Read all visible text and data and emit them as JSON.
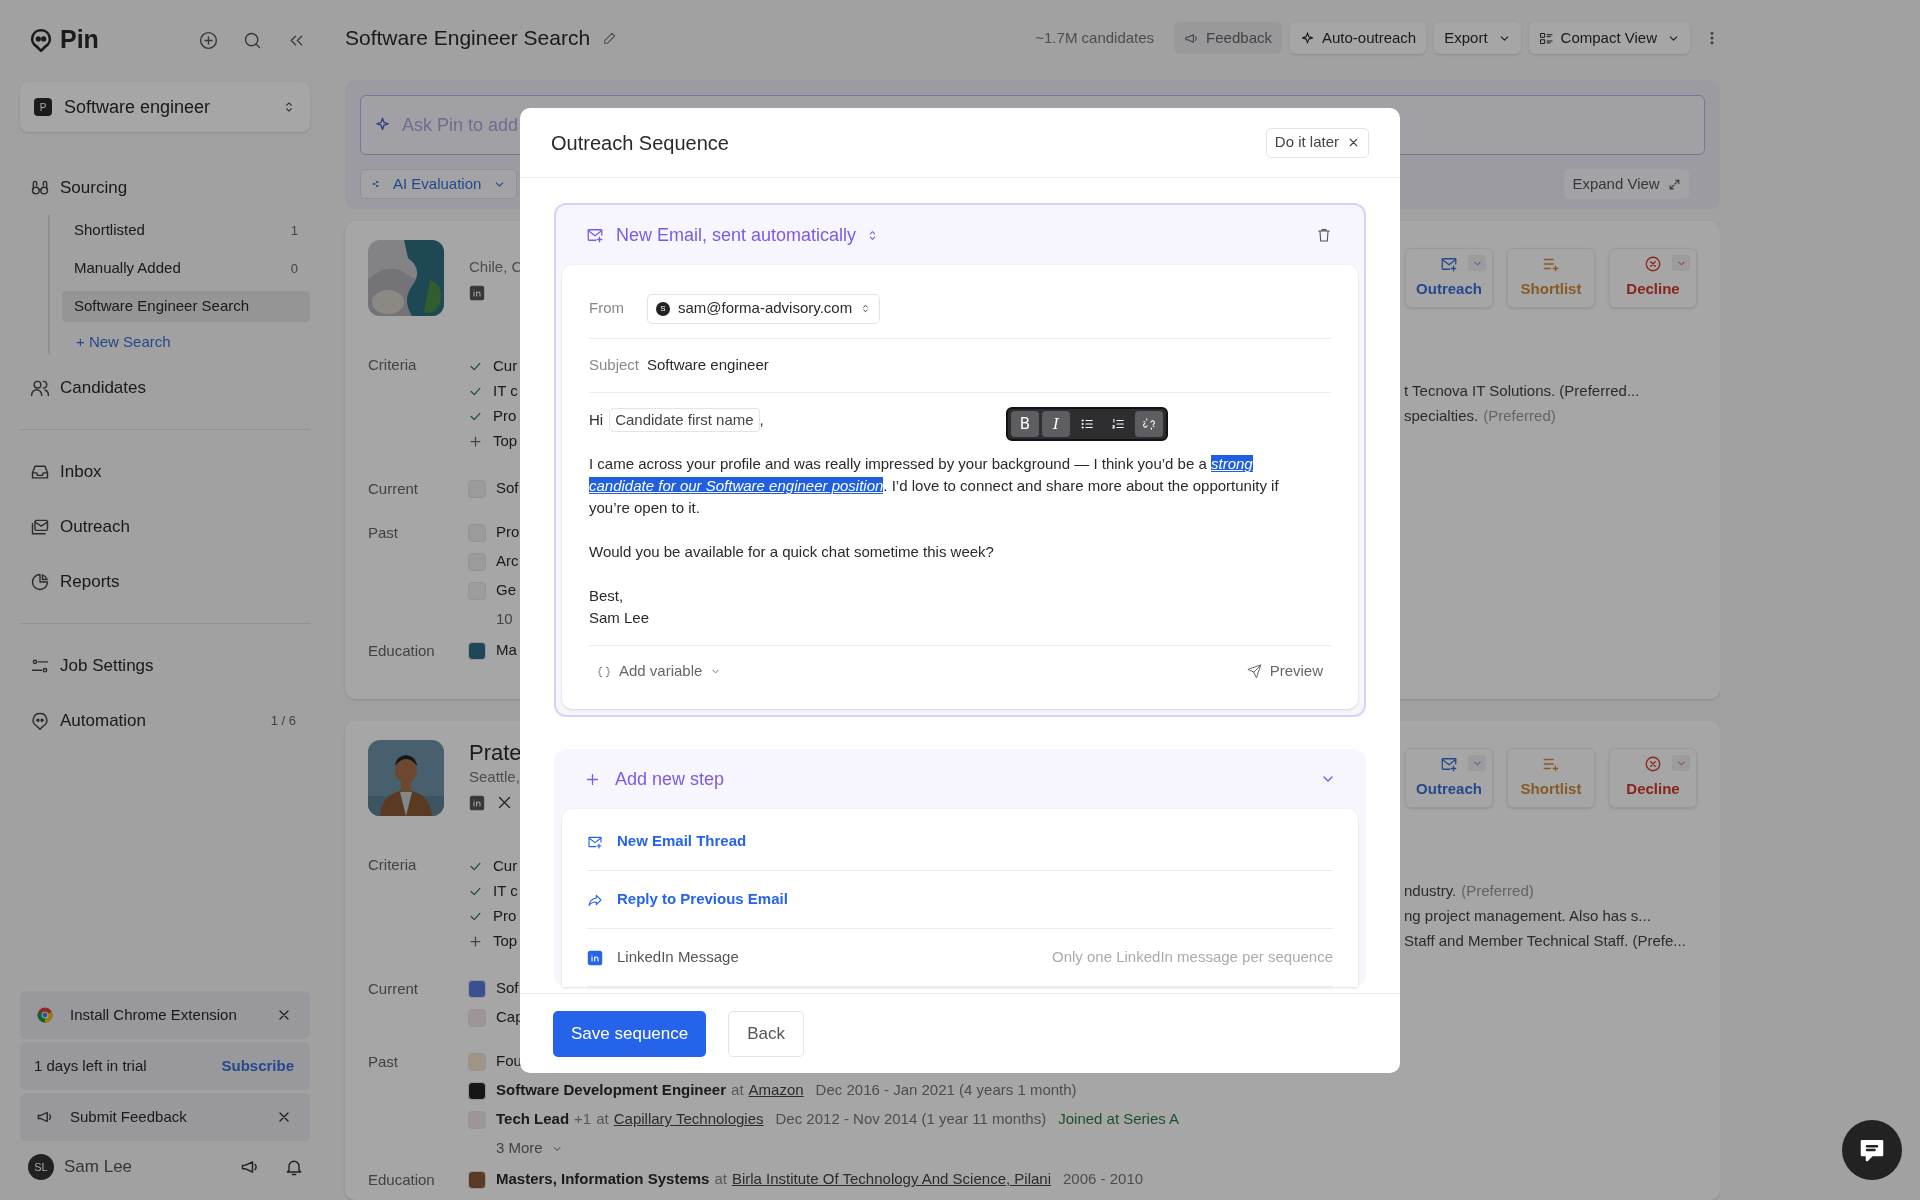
{
  "sidebar": {
    "brand": "Pin",
    "project": {
      "badge": "P",
      "name": "Software engineer"
    },
    "nav_groups": [
      [
        {
          "label": "Sourcing",
          "children": [
            {
              "label": "Shortlisted",
              "count": "1",
              "selected": false
            },
            {
              "label": "Manually Added",
              "count": "0",
              "selected": false
            },
            {
              "label": "Software Engineer Search",
              "selected": true
            }
          ],
          "add": "+ New Search"
        },
        {
          "label": "Candidates"
        }
      ],
      [
        {
          "label": "Inbox"
        },
        {
          "label": "Outreach"
        },
        {
          "label": "Reports"
        }
      ],
      [
        {
          "label": "Job Settings"
        },
        {
          "label": "Automation",
          "count": "1 / 6"
        }
      ]
    ],
    "notices": [
      {
        "kind": "dismissable",
        "label": "Install Chrome Extension"
      },
      {
        "kind": "trial",
        "label": "1 days left in trial",
        "action": "Subscribe"
      },
      {
        "kind": "dismissable",
        "label": "Submit Feedback"
      }
    ],
    "user": {
      "initials": "SL",
      "name": "Sam Lee"
    }
  },
  "header": {
    "title": "Software Engineer Search",
    "count": "~1.7M candidates",
    "actions": [
      {
        "kind": "plain",
        "label": "Feedback"
      },
      {
        "kind": "raised",
        "label": "Auto-outreach"
      },
      {
        "kind": "dropdown",
        "label": "Export"
      },
      {
        "kind": "view",
        "label": "Compact View"
      }
    ]
  },
  "search": {
    "placeholder": "Ask Pin to add",
    "filters": [
      {
        "label": "AI Evaluation"
      }
    ],
    "expand": "Expand View"
  },
  "candidates": [
    {
      "location": "Chile, C",
      "criteria_label": "Criteria",
      "criteria": [
        {
          "met": true,
          "text": "Cur"
        },
        {
          "met": true,
          "text": "IT c",
          "note": "t Tecnova IT Solutions. (Preferred..."
        },
        {
          "met": true,
          "text": "Pro",
          "note": "specialties.",
          "note_hint": "(Preferred)"
        },
        {
          "met": false,
          "text": "Top"
        }
      ],
      "current_label": "Current",
      "current": [
        {
          "text": "Sof"
        }
      ],
      "past_label": "Past",
      "past": [
        {
          "text": "Pro"
        },
        {
          "text": "Arc"
        },
        {
          "text": "Ge"
        },
        {
          "kind": "more",
          "text": "10"
        }
      ],
      "education_label": "Education",
      "education": [
        {
          "text": "Ma"
        }
      ],
      "actions": [
        {
          "kind": "outreach",
          "label": "Outreach"
        },
        {
          "kind": "shortlist",
          "label": "Shortlist"
        },
        {
          "kind": "decline",
          "label": "Decline"
        }
      ]
    },
    {
      "name": "Prate",
      "location": "Seattle,",
      "criteria_label": "Criteria",
      "criteria": [
        {
          "met": true,
          "text": "Cur"
        },
        {
          "met": true,
          "text": "IT c",
          "note": "ndustry.",
          "note_hint": "(Preferred)"
        },
        {
          "met": true,
          "text": "Pro",
          "note": "ng project management. Also has s..."
        },
        {
          "met": false,
          "text": "Top",
          "note": "Staff and Member Technical Staff. (Prefe..."
        }
      ],
      "current_label": "Current",
      "current": [
        {
          "text": "Sof"
        },
        {
          "text": "Cap"
        }
      ],
      "past_label": "Past",
      "past": [
        {
          "text": "Fou"
        },
        {
          "title": "Software Development Engineer",
          "joiner": "at",
          "company": "Amazon",
          "dates": "Dec 2016 - Jan 2021 (4 years 1 month)"
        },
        {
          "title": "Tech Lead",
          "extra": "+1",
          "joiner": "at",
          "company": "Capillary Technologies",
          "dates": "Dec 2012 - Nov 2014 (1 year 11 months)",
          "tag": "Joined at Series A"
        },
        {
          "kind": "more",
          "text": "3 More",
          "caret": true
        }
      ],
      "education_label": "Education",
      "education": [
        {
          "title": "Masters, Information Systems",
          "joiner": "at",
          "company": "Birla Institute Of Technology And Science, Pilani",
          "dates": "2006 - 2010"
        }
      ],
      "actions": [
        {
          "kind": "outreach",
          "label": "Outreach"
        },
        {
          "kind": "shortlist",
          "label": "Shortlist"
        },
        {
          "kind": "decline",
          "label": "Decline"
        }
      ]
    }
  ],
  "modal": {
    "title": "Outreach Sequence",
    "dismiss": "Do it later",
    "email": {
      "title": "New Email, sent automatically",
      "from_label": "From",
      "from": {
        "initial": "S",
        "email": "sam@forma-advisory.com"
      },
      "subject_label": "Subject",
      "subject": "Software engineer",
      "greeting": {
        "text": "Hi",
        "variable": "Candidate first name",
        "after": ","
      },
      "toolbar": [
        {
          "kind": "bold",
          "label": "B",
          "active": true
        },
        {
          "kind": "italic",
          "label": "I",
          "active": true
        },
        {
          "kind": "bullets",
          "active": false
        },
        {
          "kind": "numbers",
          "active": false
        },
        {
          "kind": "link",
          "active": true
        }
      ],
      "paragraphs": [
        [
          "I came across your profile and was really impressed by your background — I think you’d be a *strong candidate for our Software engineer position*. I’d love to connect and share more about the opportunity if you’re open to it."
        ],
        [
          "Would you be available for a quick chat sometime this week?"
        ],
        [
          "Best,",
          "Sam Lee"
        ]
      ],
      "add_variable": "Add variable",
      "preview": "Preview"
    },
    "add_step": {
      "label": "Add new step",
      "expanded": true,
      "options": [
        {
          "label": "New Email Thread",
          "disabled": false
        },
        {
          "label": "Reply to Previous Email",
          "disabled": false
        },
        {
          "label": "LinkedIn Message",
          "disabled": true,
          "note": "Only one LinkedIn message per sequence"
        }
      ]
    },
    "buttons": [
      {
        "kind": "primary",
        "label": "Save sequence"
      },
      {
        "kind": "secondary",
        "label": "Back"
      }
    ]
  }
}
